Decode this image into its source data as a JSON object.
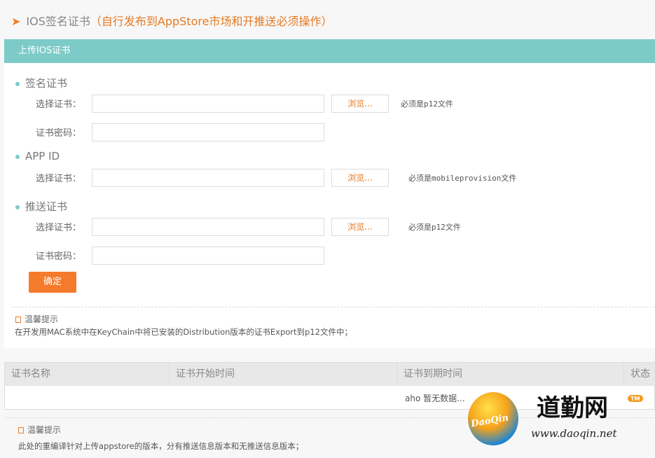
{
  "header": {
    "title": "IOS签名证书",
    "subtitle": "（自行发布到AppStore市场和开推送必须操作）"
  },
  "panel": {
    "title": "上传IOS证书",
    "sections": [
      {
        "title": "签名证书",
        "select_label": "选择证书：",
        "browse": "浏览...",
        "hint": "必须是p12文件",
        "password_label": "证书密码："
      },
      {
        "title": "APP ID",
        "select_label": "选择证书：",
        "browse": "浏览...",
        "hint": "必须是mobileprovision文件"
      },
      {
        "title": "推送证书",
        "select_label": "选择证书：",
        "browse": "浏览...",
        "hint": "必须是p12文件",
        "password_label": "证书密码："
      }
    ],
    "confirm": "确定",
    "tip": {
      "title": "温馨提示",
      "text": "在开发用MAC系统中在KeyChain中将已安装的Distribution版本的证书Export到p12文件中；"
    }
  },
  "table": {
    "columns": [
      "证书名称",
      "证书开始时间",
      "证书到期时间",
      "状态"
    ],
    "empty": "aho 暂无数据..."
  },
  "tip2": {
    "title": "温馨提示",
    "text": "此处的重编译针对上传appstore的版本，分有推送信息版本和无推送信息版本；"
  },
  "watermark": {
    "badge": "DaoQin",
    "name": "道勤网",
    "tm": "TM",
    "url": "www.daoqin.net"
  },
  "colors": {
    "accent": "#f47b2c",
    "teal": "#7ccbc8"
  }
}
